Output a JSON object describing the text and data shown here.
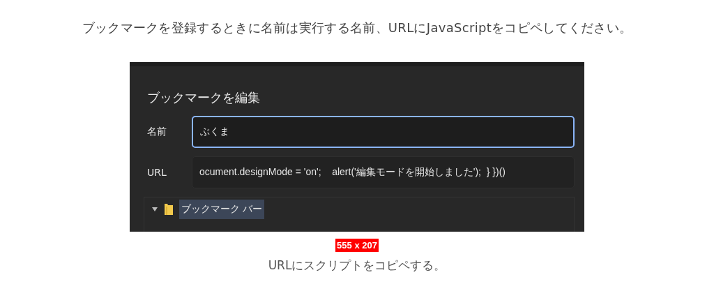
{
  "intro": "ブックマークを登録するときに名前は実行する名前、URLにJavaScriptをコピペしてください。",
  "dialog": {
    "title": "ブックマークを編集",
    "fields": [
      {
        "label": "名前",
        "value": "ぶくま",
        "focused": true
      },
      {
        "label": "URL",
        "value": "ocument.designMode = 'on';    alert('編集モードを開始しました');  } })()",
        "focused": false
      }
    ],
    "tree": [
      {
        "label": "ブックマーク バー",
        "expanded": true,
        "selected": true
      }
    ]
  },
  "size_badge": "555 x 207",
  "caption": "URLにスクリプトをコピペする。"
}
